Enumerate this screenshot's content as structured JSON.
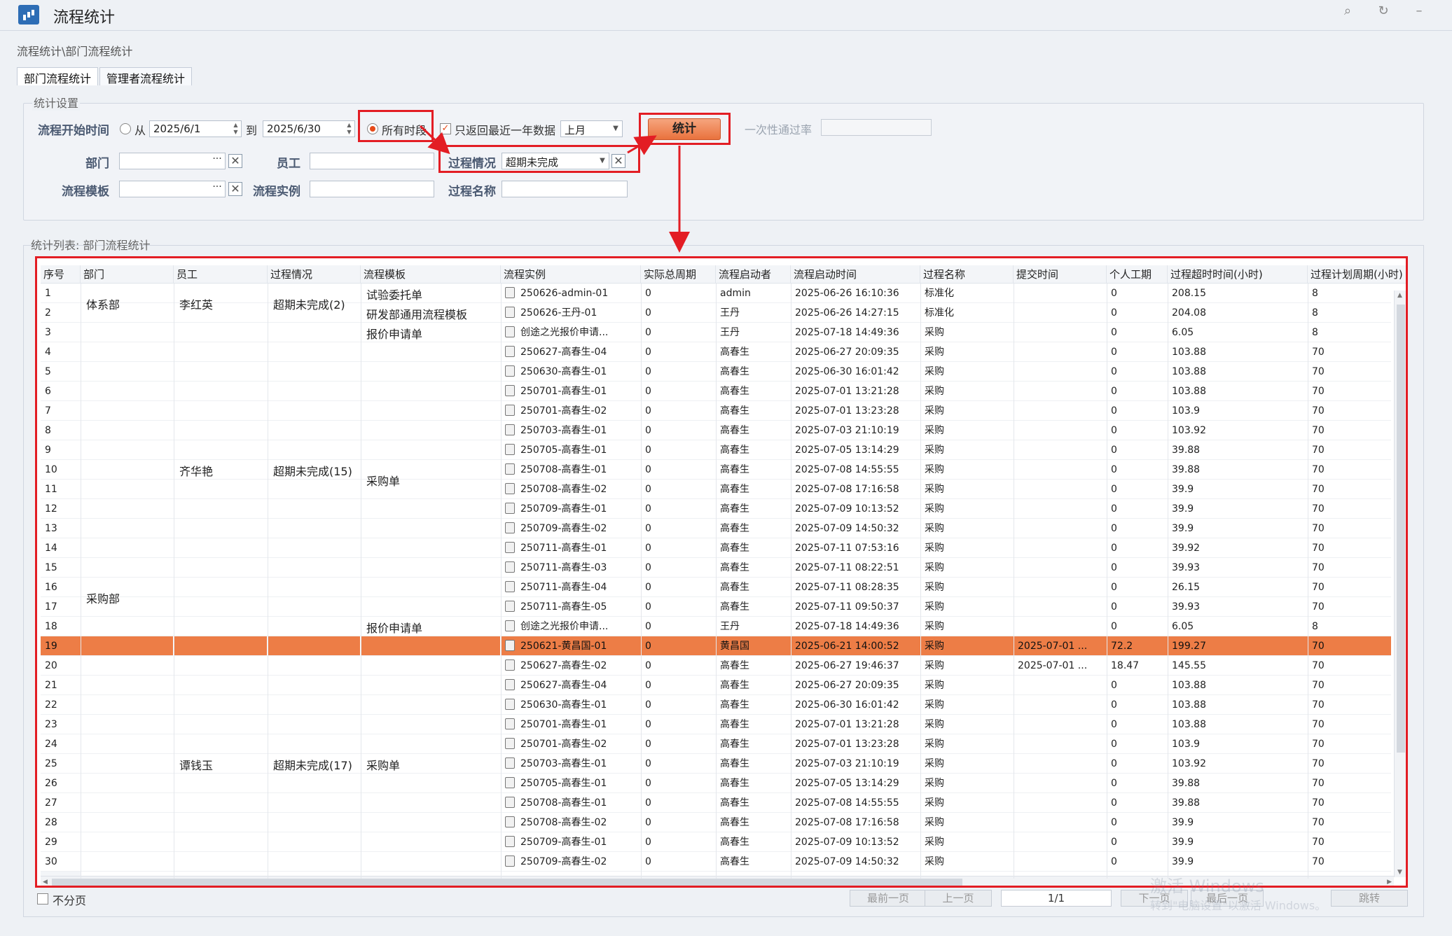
{
  "window": {
    "title": "流程统计"
  },
  "breadcrumb": "流程统计\\部门流程统计",
  "tabs": [
    {
      "label": "部门流程统计",
      "active": true
    },
    {
      "label": "管理者流程统计",
      "active": false
    }
  ],
  "settings": {
    "legend": "统计设置",
    "start_time_label": "流程开始时间",
    "from_label": "从",
    "from_date": "2025/6/1",
    "to_label": "到",
    "to_date": "2025/6/30",
    "all_period_label": "所有时段",
    "only_recent_label": "只返回最近一年数据",
    "period_select": "上月",
    "stat_button": "统计",
    "pass_rate_label": "一次性通过率",
    "pass_rate_value": "",
    "dept_label": "部门",
    "dept_value": "",
    "employee_label": "员工",
    "employee_value": "",
    "process_status_label": "过程情况",
    "process_status_value": "超期未完成",
    "template_label": "流程模板",
    "template_value": "",
    "instance_label": "流程实例",
    "instance_value": "",
    "process_name_label": "过程名称",
    "process_name_value": ""
  },
  "list": {
    "legend": "统计列表: 部门流程统计",
    "columns": [
      "序号",
      "部门",
      "员工",
      "过程情况",
      "流程模板",
      "流程实例",
      "实际总周期",
      "流程启动者",
      "流程启动时间",
      "过程名称",
      "提交时间",
      "个人工期",
      "过程超时时间(小时)",
      "过程计划周期(小时)"
    ],
    "groups": {
      "dept": [
        {
          "text": "体系部",
          "row_start": 1,
          "row_end": 2
        },
        {
          "text": "采购部",
          "row_start": 3,
          "row_end": 30
        }
      ],
      "employee": [
        {
          "text": "李红英",
          "row_start": 1,
          "row_end": 2
        },
        {
          "text": "齐华艳",
          "row_start": 3,
          "row_end": 17
        },
        {
          "text": "谭钱玉",
          "row_start": 20,
          "row_end": 30
        }
      ],
      "status": [
        {
          "text": "超期未完成(2)",
          "row_start": 1,
          "row_end": 2
        },
        {
          "text": "超期未完成(15)",
          "row_start": 3,
          "row_end": 17
        },
        {
          "text": "超期未完成(17)",
          "row_start": 20,
          "row_end": 30
        }
      ],
      "template": [
        {
          "text": "试验委托单",
          "row_start": 1,
          "row_end": 1
        },
        {
          "text": "研发部通用流程模板",
          "row_start": 2,
          "row_end": 2
        },
        {
          "text": "报价申请单",
          "row_start": 3,
          "row_end": 3
        },
        {
          "text": "采购单",
          "row_start": 4,
          "row_end": 17
        },
        {
          "text": "报价申请单",
          "row_start": 18,
          "row_end": 18
        },
        {
          "text": "采购单",
          "row_start": 20,
          "row_end": 30
        }
      ]
    },
    "rows": [
      {
        "no": "1",
        "instance": "250626-admin-01",
        "cycle": "0",
        "starter": "admin",
        "start": "2025-06-26 16:10:36",
        "proc": "标准化",
        "submit": "",
        "personal": "0",
        "overtime": "208.15",
        "plan": "8"
      },
      {
        "no": "2",
        "instance": "250626-王丹-01",
        "cycle": "0",
        "starter": "王丹",
        "start": "2025-06-26 14:27:15",
        "proc": "标准化",
        "submit": "",
        "personal": "0",
        "overtime": "204.08",
        "plan": "8"
      },
      {
        "no": "3",
        "instance": "创途之光报价申请...",
        "cycle": "0",
        "starter": "王丹",
        "start": "2025-07-18 14:49:36",
        "proc": "采购",
        "submit": "",
        "personal": "0",
        "overtime": "6.05",
        "plan": "8"
      },
      {
        "no": "4",
        "instance": "250627-高春生-04",
        "cycle": "0",
        "starter": "高春生",
        "start": "2025-06-27 20:09:35",
        "proc": "采购",
        "submit": "",
        "personal": "0",
        "overtime": "103.88",
        "plan": "70"
      },
      {
        "no": "5",
        "instance": "250630-高春生-01",
        "cycle": "0",
        "starter": "高春生",
        "start": "2025-06-30 16:01:42",
        "proc": "采购",
        "submit": "",
        "personal": "0",
        "overtime": "103.88",
        "plan": "70"
      },
      {
        "no": "6",
        "instance": "250701-高春生-01",
        "cycle": "0",
        "starter": "高春生",
        "start": "2025-07-01 13:21:28",
        "proc": "采购",
        "submit": "",
        "personal": "0",
        "overtime": "103.88",
        "plan": "70"
      },
      {
        "no": "7",
        "instance": "250701-高春生-02",
        "cycle": "0",
        "starter": "高春生",
        "start": "2025-07-01 13:23:28",
        "proc": "采购",
        "submit": "",
        "personal": "0",
        "overtime": "103.9",
        "plan": "70"
      },
      {
        "no": "8",
        "instance": "250703-高春生-01",
        "cycle": "0",
        "starter": "高春生",
        "start": "2025-07-03 21:10:19",
        "proc": "采购",
        "submit": "",
        "personal": "0",
        "overtime": "103.92",
        "plan": "70"
      },
      {
        "no": "9",
        "instance": "250705-高春生-01",
        "cycle": "0",
        "starter": "高春生",
        "start": "2025-07-05 13:14:29",
        "proc": "采购",
        "submit": "",
        "personal": "0",
        "overtime": "39.88",
        "plan": "70"
      },
      {
        "no": "10",
        "instance": "250708-高春生-01",
        "cycle": "0",
        "starter": "高春生",
        "start": "2025-07-08 14:55:55",
        "proc": "采购",
        "submit": "",
        "personal": "0",
        "overtime": "39.88",
        "plan": "70"
      },
      {
        "no": "11",
        "instance": "250708-高春生-02",
        "cycle": "0",
        "starter": "高春生",
        "start": "2025-07-08 17:16:58",
        "proc": "采购",
        "submit": "",
        "personal": "0",
        "overtime": "39.9",
        "plan": "70"
      },
      {
        "no": "12",
        "instance": "250709-高春生-01",
        "cycle": "0",
        "starter": "高春生",
        "start": "2025-07-09 10:13:52",
        "proc": "采购",
        "submit": "",
        "personal": "0",
        "overtime": "39.9",
        "plan": "70"
      },
      {
        "no": "13",
        "instance": "250709-高春生-02",
        "cycle": "0",
        "starter": "高春生",
        "start": "2025-07-09 14:50:32",
        "proc": "采购",
        "submit": "",
        "personal": "0",
        "overtime": "39.9",
        "plan": "70"
      },
      {
        "no": "14",
        "instance": "250711-高春生-01",
        "cycle": "0",
        "starter": "高春生",
        "start": "2025-07-11 07:53:16",
        "proc": "采购",
        "submit": "",
        "personal": "0",
        "overtime": "39.92",
        "plan": "70"
      },
      {
        "no": "15",
        "instance": "250711-高春生-03",
        "cycle": "0",
        "starter": "高春生",
        "start": "2025-07-11 08:22:51",
        "proc": "采购",
        "submit": "",
        "personal": "0",
        "overtime": "39.93",
        "plan": "70"
      },
      {
        "no": "16",
        "instance": "250711-高春生-04",
        "cycle": "0",
        "starter": "高春生",
        "start": "2025-07-11 08:28:35",
        "proc": "采购",
        "submit": "",
        "personal": "0",
        "overtime": "26.15",
        "plan": "70"
      },
      {
        "no": "17",
        "instance": "250711-高春生-05",
        "cycle": "0",
        "starter": "高春生",
        "start": "2025-07-11 09:50:37",
        "proc": "采购",
        "submit": "",
        "personal": "0",
        "overtime": "39.93",
        "plan": "70"
      },
      {
        "no": "18",
        "instance": "创途之光报价申请...",
        "cycle": "0",
        "starter": "王丹",
        "start": "2025-07-18 14:49:36",
        "proc": "采购",
        "submit": "",
        "personal": "0",
        "overtime": "6.05",
        "plan": "8"
      },
      {
        "no": "19",
        "instance": "250621-黄昌国-01",
        "cycle": "0",
        "starter": "黄昌国",
        "start": "2025-06-21 14:00:52",
        "proc": "采购",
        "submit": "2025-07-01 ...",
        "personal": "72.2",
        "overtime": "199.27",
        "plan": "70",
        "selected": true
      },
      {
        "no": "20",
        "instance": "250627-高春生-02",
        "cycle": "0",
        "starter": "高春生",
        "start": "2025-06-27 19:46:37",
        "proc": "采购",
        "submit": "2025-07-01 ...",
        "personal": "18.47",
        "overtime": "145.55",
        "plan": "70"
      },
      {
        "no": "21",
        "instance": "250627-高春生-04",
        "cycle": "0",
        "starter": "高春生",
        "start": "2025-06-27 20:09:35",
        "proc": "采购",
        "submit": "",
        "personal": "0",
        "overtime": "103.88",
        "plan": "70"
      },
      {
        "no": "22",
        "instance": "250630-高春生-01",
        "cycle": "0",
        "starter": "高春生",
        "start": "2025-06-30 16:01:42",
        "proc": "采购",
        "submit": "",
        "personal": "0",
        "overtime": "103.88",
        "plan": "70"
      },
      {
        "no": "23",
        "instance": "250701-高春生-01",
        "cycle": "0",
        "starter": "高春生",
        "start": "2025-07-01 13:21:28",
        "proc": "采购",
        "submit": "",
        "personal": "0",
        "overtime": "103.88",
        "plan": "70"
      },
      {
        "no": "24",
        "instance": "250701-高春生-02",
        "cycle": "0",
        "starter": "高春生",
        "start": "2025-07-01 13:23:28",
        "proc": "采购",
        "submit": "",
        "personal": "0",
        "overtime": "103.9",
        "plan": "70"
      },
      {
        "no": "25",
        "instance": "250703-高春生-01",
        "cycle": "0",
        "starter": "高春生",
        "start": "2025-07-03 21:10:19",
        "proc": "采购",
        "submit": "",
        "personal": "0",
        "overtime": "103.92",
        "plan": "70"
      },
      {
        "no": "26",
        "instance": "250705-高春生-01",
        "cycle": "0",
        "starter": "高春生",
        "start": "2025-07-05 13:14:29",
        "proc": "采购",
        "submit": "",
        "personal": "0",
        "overtime": "39.88",
        "plan": "70"
      },
      {
        "no": "27",
        "instance": "250708-高春生-01",
        "cycle": "0",
        "starter": "高春生",
        "start": "2025-07-08 14:55:55",
        "proc": "采购",
        "submit": "",
        "personal": "0",
        "overtime": "39.88",
        "plan": "70"
      },
      {
        "no": "28",
        "instance": "250708-高春生-02",
        "cycle": "0",
        "starter": "高春生",
        "start": "2025-07-08 17:16:58",
        "proc": "采购",
        "submit": "",
        "personal": "0",
        "overtime": "39.9",
        "plan": "70"
      },
      {
        "no": "29",
        "instance": "250709-高春生-01",
        "cycle": "0",
        "starter": "高春生",
        "start": "2025-07-09 10:13:52",
        "proc": "采购",
        "submit": "",
        "personal": "0",
        "overtime": "39.9",
        "plan": "70"
      },
      {
        "no": "30",
        "instance": "250709-高春生-02",
        "cycle": "0",
        "starter": "高春生",
        "start": "2025-07-09 14:50:32",
        "proc": "采购",
        "submit": "",
        "personal": "0",
        "overtime": "39.9",
        "plan": "70"
      }
    ]
  },
  "footer": {
    "no_paging_label": "不分页",
    "first_page": "最前一页",
    "prev_page": "上一页",
    "page_indicator": "1/1",
    "next_page": "下一页",
    "last_page": "最后一页",
    "jump": "跳转"
  },
  "watermark": {
    "line1": "激活 Windows",
    "line2": "转到\"电脑设置\"以激活 Windows。"
  },
  "colors": {
    "selected_row": "#ed7d46",
    "annotation_red": "#e31d24",
    "accent_orange": "#e9723d"
  }
}
